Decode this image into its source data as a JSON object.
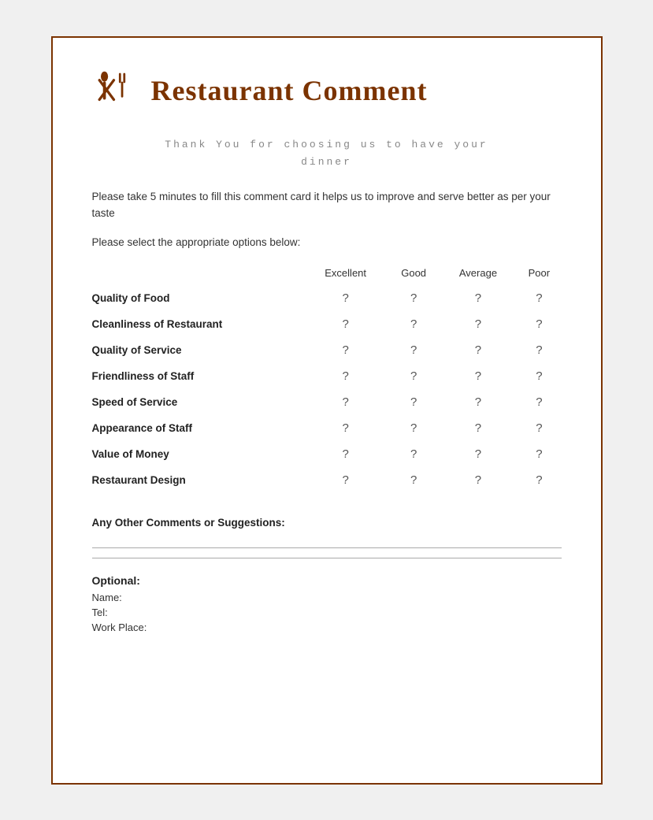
{
  "header": {
    "title": "Restaurant Comment"
  },
  "subtitle": {
    "line1": "Thank You for choosing us to have your",
    "line2": "dinner"
  },
  "description": "Please take 5 minutes to fill this comment card it helps us to improve and serve better as per your taste",
  "instruction": "Please select the appropriate options below:",
  "columns": [
    "Excellent",
    "Good",
    "Average",
    "Poor"
  ],
  "rows": [
    {
      "label": "Quality of Food",
      "values": [
        "?",
        "?",
        "?",
        "?"
      ]
    },
    {
      "label": "Cleanliness of Restaurant",
      "values": [
        "?",
        "?",
        "?",
        "?"
      ]
    },
    {
      "label": "Quality of Service",
      "values": [
        "?",
        "?",
        "?",
        "?"
      ]
    },
    {
      "label": "Friendliness of Staff",
      "values": [
        "?",
        "?",
        "?",
        "?"
      ]
    },
    {
      "label": "Speed of Service",
      "values": [
        "?",
        "?",
        "?",
        "?"
      ]
    },
    {
      "label": "Appearance of Staff",
      "values": [
        "?",
        "?",
        "?",
        "?"
      ]
    },
    {
      "label": "Value of Money",
      "values": [
        "?",
        "?",
        "?",
        "?"
      ]
    },
    {
      "label": "Restaurant Design",
      "values": [
        "?",
        "?",
        "?",
        "?"
      ]
    }
  ],
  "comments": {
    "label": "Any Other Comments or Suggestions:"
  },
  "optional": {
    "title": "Optional:",
    "fields": [
      "Name:",
      "Tel:",
      "Work Place:"
    ]
  }
}
